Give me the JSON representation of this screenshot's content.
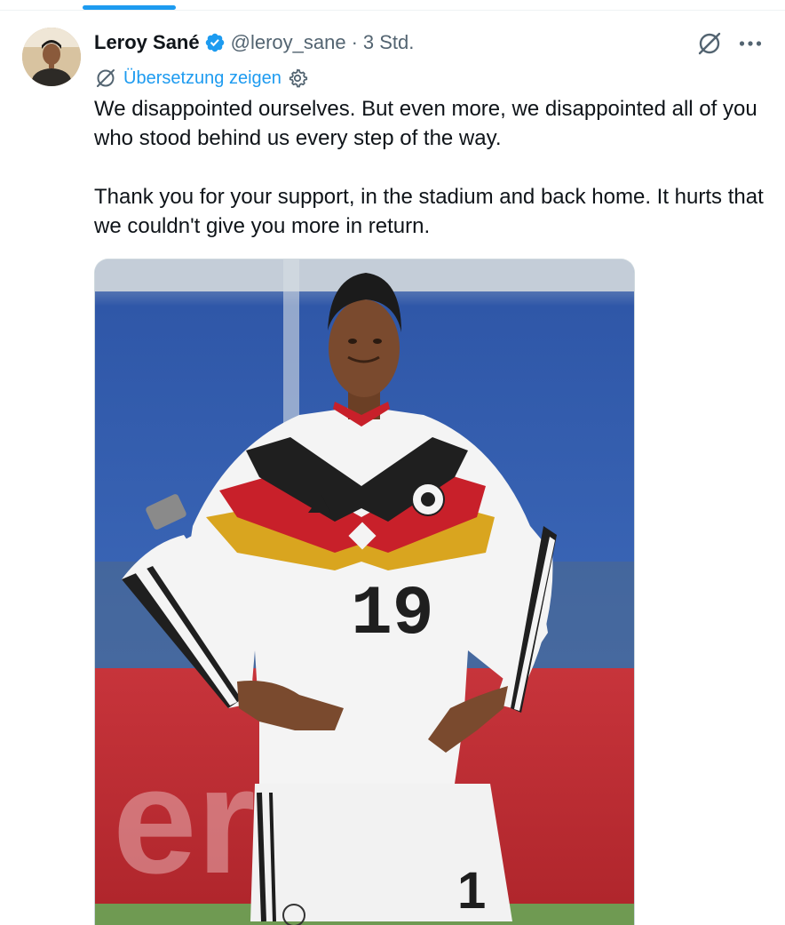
{
  "author": {
    "display_name": "Leroy Sané",
    "handle": "@leroy_sane",
    "separator": "·",
    "timestamp": "3 Std.",
    "verified": true
  },
  "translate": {
    "label": "Übersetzung zeigen"
  },
  "tweet": {
    "paragraphs": [
      "We disappointed ourselves. But even more, we disappointed all of you who stood behind us every step of the way.",
      "Thank you for your support, in the stadium and back home. It hurts that we couldn't give you more in return."
    ]
  },
  "media": {
    "jersey_number": "19"
  },
  "colors": {
    "accent": "#1d9bf0",
    "text_primary": "#0f1419",
    "text_secondary": "#536471"
  },
  "icons": [
    "verified-badge-icon",
    "grok-icon",
    "more-icon",
    "translate-icon",
    "settings-icon"
  ]
}
